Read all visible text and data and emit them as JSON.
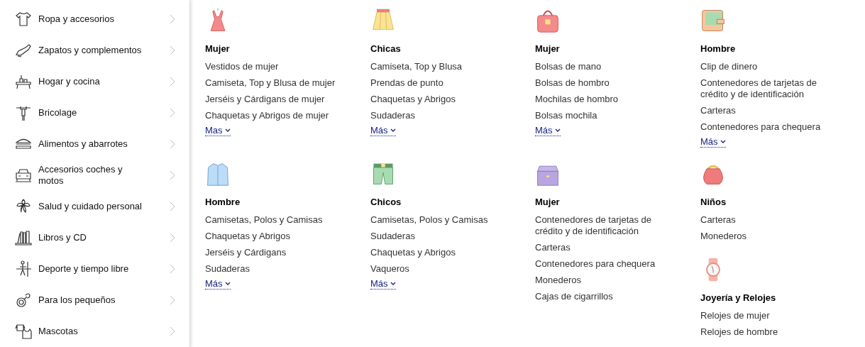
{
  "sidebar": {
    "items": [
      {
        "label": "Ropa y accesorios"
      },
      {
        "label": "Zapatos y complementos"
      },
      {
        "label": "Hogar y cocina"
      },
      {
        "label": "Bricolage"
      },
      {
        "label": "Alimentos y abarrotes"
      },
      {
        "label": "Accesorios coches y motos"
      },
      {
        "label": "Salud y cuidado personal"
      },
      {
        "label": "Libros y CD"
      },
      {
        "label": "Deporte y tiempo libre"
      },
      {
        "label": "Para los pequeños"
      },
      {
        "label": "Mascotas"
      }
    ]
  },
  "panel": {
    "rows": [
      [
        [
          {
            "title": "Mujer",
            "links": [
              "Vestidos de mujer",
              "Camiseta, Top y Blusa de mujer",
              "Jerséis y Cárdigans de mujer",
              "Chaquetas y Abrigos de mujer"
            ],
            "more": "Mas"
          }
        ],
        [
          {
            "title": "Chicas",
            "links": [
              "Camiseta, Top y Blusa",
              "Prendas de punto",
              "Chaquetas y Abrigos",
              "Sudaderas"
            ],
            "more": "Más"
          }
        ],
        [
          {
            "title": "Mujer",
            "links": [
              "Bolsas de mano",
              "Bolsas de hombro",
              "Mochilas de hombro",
              "Bolsas mochila"
            ],
            "more": "Más"
          }
        ],
        [
          {
            "title": "Hombre",
            "links": [
              "Clip de dinero",
              "Contenedores de tarjetas de crédito y de identificación",
              "Carteras",
              "Contenedores para chequera"
            ],
            "more": "Más"
          }
        ]
      ],
      [
        [
          {
            "title": "Hombre",
            "links": [
              "Camisetas, Polos y Camisas",
              "Chaquetas y Abrigos",
              "Jerséis y Cárdigans",
              "Sudaderas"
            ],
            "more": "Más"
          }
        ],
        [
          {
            "title": "Chicos",
            "links": [
              "Camisetas, Polos y Camisas",
              "Sudaderas",
              "Chaquetas y Abrigos",
              "Vaqueros"
            ],
            "more": "Más"
          }
        ],
        [
          {
            "title": "Mujer",
            "links": [
              "Contenedores de tarjetas de crédito y de identificación",
              "Carteras",
              "Contenedores para chequera",
              "Monederos",
              "Cajas de cigarrillos"
            ]
          }
        ],
        [
          {
            "title": "Niños",
            "links": [
              "Carteras",
              "Monederos"
            ]
          },
          {
            "title": "Joyería y Relojes",
            "links": [
              "Relojes de mujer",
              "Relojes de hombre"
            ]
          }
        ]
      ]
    ]
  }
}
